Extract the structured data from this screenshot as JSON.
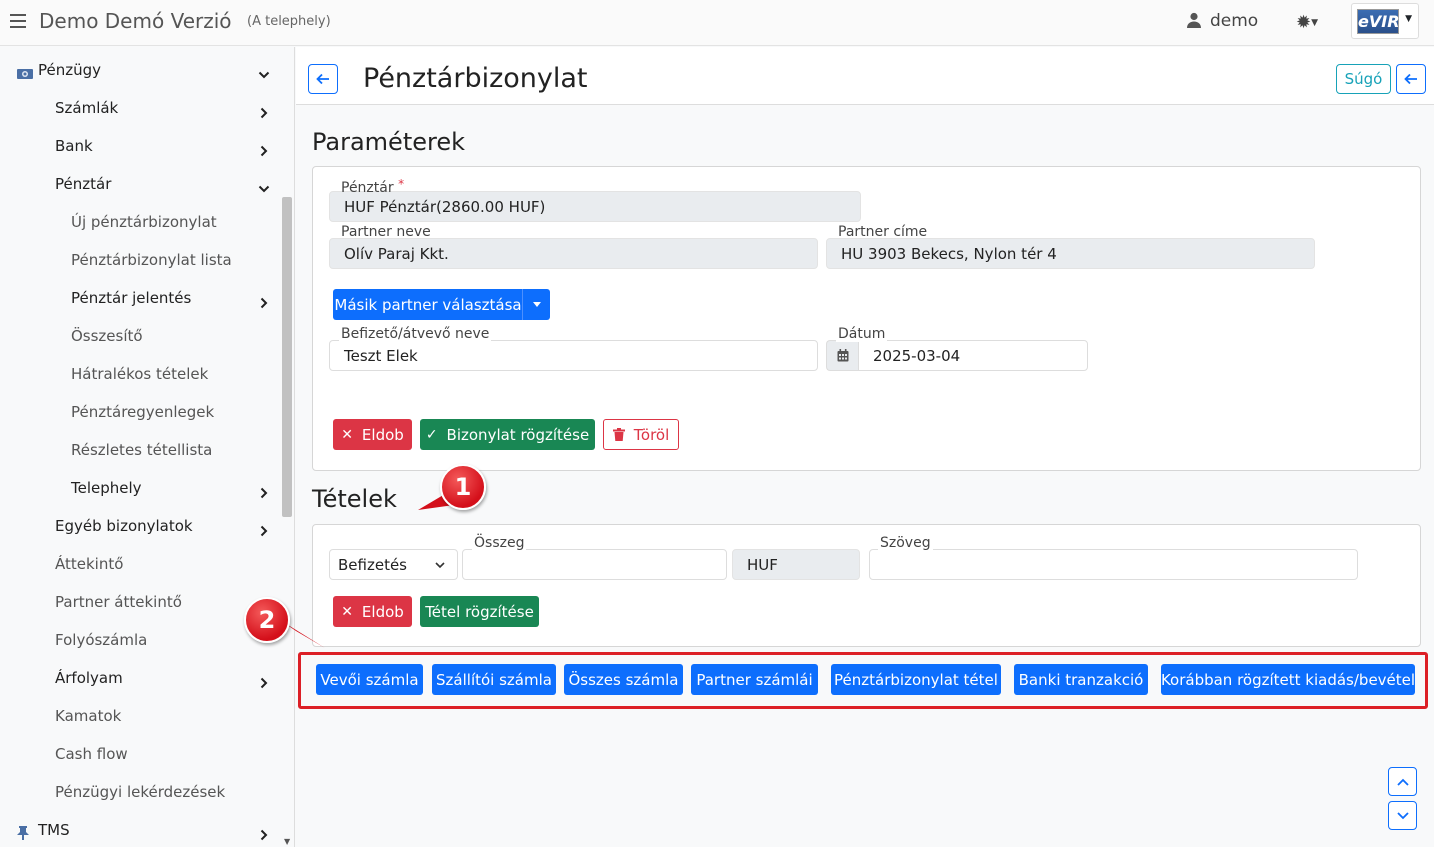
{
  "app": {
    "title": "Demo Demó Verzió",
    "subtitle": "(A telephely)",
    "user": "demo",
    "logo_text": "eVIR"
  },
  "sidebar": {
    "items": [
      {
        "label": "Pénzügy",
        "level": 0,
        "chevron": "down",
        "icon": "money-icon"
      },
      {
        "label": "Számlák",
        "level": 1,
        "chevron": "right"
      },
      {
        "label": "Bank",
        "level": 1,
        "chevron": "right"
      },
      {
        "label": "Pénztár",
        "level": 1,
        "chevron": "down"
      },
      {
        "label": "Új pénztárbizonylat",
        "level": 2
      },
      {
        "label": "Pénztárbizonylat lista",
        "level": 2
      },
      {
        "label": "Pénztár jelentés",
        "level": 2,
        "chevron": "right"
      },
      {
        "label": "Összesítő",
        "level": 2
      },
      {
        "label": "Hátralékos tételek",
        "level": 2
      },
      {
        "label": "Pénztáregyenlegek",
        "level": 2
      },
      {
        "label": "Részletes tétellista",
        "level": 2
      },
      {
        "label": "Telephely",
        "level": 2,
        "chevron": "right"
      },
      {
        "label": "Egyéb bizonylatok",
        "level": 1,
        "chevron": "right"
      },
      {
        "label": "Áttekintő",
        "level": 1
      },
      {
        "label": "Partner áttekintő",
        "level": 1
      },
      {
        "label": "Folyószámla",
        "level": 1
      },
      {
        "label": "Árfolyam",
        "level": 1,
        "chevron": "right"
      },
      {
        "label": "Kamatok",
        "level": 1
      },
      {
        "label": "Cash flow",
        "level": 1
      },
      {
        "label": "Pénzügyi lekérdezések",
        "level": 1
      },
      {
        "label": "TMS",
        "level": 0,
        "chevron": "right",
        "icon": "pin-icon"
      }
    ]
  },
  "page": {
    "title": "Pénztárbizonylat",
    "help_label": "Súgó"
  },
  "params": {
    "section_title": "Paraméterek",
    "penztar_label": "Pénztár",
    "penztar_value": "HUF Pénztár(2860.00 HUF)",
    "partner_name_label": "Partner neve",
    "partner_name_value": "Olív  Paraj Kkt.",
    "partner_addr_label": "Partner címe",
    "partner_addr_value": "HU 3903 Bekecs, Nylon tér 4",
    "other_partner_button": "Másik partner választása",
    "payer_label": "Befizető/átvevő neve",
    "payer_value": "Teszt Elek",
    "date_label": "Dátum",
    "date_value": "2025-03-04",
    "discard_button": "Eldob",
    "save_button": "Bizonylat rögzítése",
    "delete_button": "Töröl"
  },
  "items": {
    "section_title": "Tételek",
    "type_value": "Befizetés",
    "amount_label": "Összeg",
    "amount_value": "",
    "currency_value": "HUF",
    "text_label": "Szöveg",
    "text_value": "",
    "discard_button": "Eldob",
    "save_button": "Tétel rögzítése"
  },
  "link_buttons": [
    "Vevői számla",
    "Szállítói számla",
    "Összes számla",
    "Partner számlái",
    "Pénztárbizonylat tétel",
    "Banki tranzakció",
    "Korábban rögzített kiadás/bevétel"
  ],
  "markers": [
    "1",
    "2"
  ],
  "colors": {
    "primary": "#0d6efd",
    "danger": "#dc3545",
    "success": "#198754",
    "info": "#17a2b8",
    "marker": "#dc1f26"
  }
}
